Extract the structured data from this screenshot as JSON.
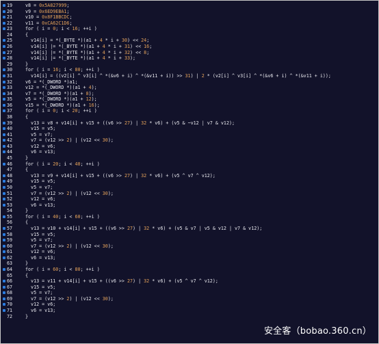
{
  "lines": [
    {
      "n": "19",
      "bullet": true,
      "code": "v8 = 0x5A827999;"
    },
    {
      "n": "20",
      "bullet": true,
      "code": "v9 = 0x6ED9EBA1;"
    },
    {
      "n": "21",
      "bullet": true,
      "code": "v10 = 0x8F1BBCDC;"
    },
    {
      "n": "22",
      "bullet": true,
      "code": "v11 = 0xCA62C1D6;"
    },
    {
      "n": "23",
      "bullet": true,
      "code": "for ( i = 0; i < 16; ++i )"
    },
    {
      "n": "24",
      "bullet": false,
      "code": "{"
    },
    {
      "n": "25",
      "bullet": true,
      "code": "  v14[i] = *(_BYTE *)(a1 + 4 * i + 30) << 24;"
    },
    {
      "n": "26",
      "bullet": true,
      "code": "  v14[i] |= *(_BYTE *)(a1 + 4 * i + 31) << 16;"
    },
    {
      "n": "27",
      "bullet": true,
      "code": "  v14[i] |= *(_BYTE *)(a1 + 4 * i + 32) << 8;"
    },
    {
      "n": "28",
      "bullet": true,
      "code": "  v14[i] |= *(_BYTE *)(a1 + 4 * i + 33);"
    },
    {
      "n": "29",
      "bullet": false,
      "code": "}"
    },
    {
      "n": "30",
      "bullet": true,
      "code": "for ( i = 16; i < 80; ++i )"
    },
    {
      "n": "31",
      "bullet": true,
      "code": "  v14[i] = ((v2[i] ^ v3[i] ^ *(&v6 + i) ^ *(&v11 + i)) >> 31) | 2 * (v2[i] ^ v3[i] ^ *(&v6 + i) ^ *(&v11 + i));"
    },
    {
      "n": "32",
      "bullet": true,
      "code": "v6 = *(_DWORD *)a1;"
    },
    {
      "n": "33",
      "bullet": true,
      "code": "v12 = *(_DWORD *)(a1 + 4);"
    },
    {
      "n": "34",
      "bullet": true,
      "code": "v7 = *(_DWORD *)(a1 + 8);"
    },
    {
      "n": "35",
      "bullet": true,
      "code": "v5 = *(_DWORD *)(a1 + 12);"
    },
    {
      "n": "36",
      "bullet": true,
      "code": "v15 = *(_DWORD *)(a1 + 16);"
    },
    {
      "n": "37",
      "bullet": true,
      "code": "for ( i = 0; i < 20; ++i )"
    },
    {
      "n": "38",
      "bullet": false,
      "code": "{"
    },
    {
      "n": "39",
      "bullet": true,
      "code": "  v13 = v8 + v14[i] + v15 + ((v6 >> 27) | 32 * v6) + (v5 & ~v12 | v7 & v12);"
    },
    {
      "n": "40",
      "bullet": true,
      "code": "  v15 = v5;"
    },
    {
      "n": "41",
      "bullet": true,
      "code": "  v5 = v7;"
    },
    {
      "n": "42",
      "bullet": true,
      "code": "  v7 = (v12 >> 2) | (v12 << 30);"
    },
    {
      "n": "43",
      "bullet": true,
      "code": "  v12 = v6;"
    },
    {
      "n": "44",
      "bullet": true,
      "code": "  v6 = v13;"
    },
    {
      "n": "45",
      "bullet": false,
      "code": "}"
    },
    {
      "n": "46",
      "bullet": true,
      "code": "for ( i = 20; i < 40; ++i )"
    },
    {
      "n": "47",
      "bullet": false,
      "code": "{"
    },
    {
      "n": "48",
      "bullet": true,
      "code": "  v13 = v9 + v14[i] + v15 + ((v6 >> 27) | 32 * v6) + (v5 ^ v7 ^ v12);"
    },
    {
      "n": "49",
      "bullet": true,
      "code": "  v15 = v5;"
    },
    {
      "n": "50",
      "bullet": true,
      "code": "  v5 = v7;"
    },
    {
      "n": "51",
      "bullet": true,
      "code": "  v7 = (v12 >> 2) | (v12 << 30);"
    },
    {
      "n": "52",
      "bullet": true,
      "code": "  v12 = v6;"
    },
    {
      "n": "53",
      "bullet": true,
      "code": "  v6 = v13;"
    },
    {
      "n": "54",
      "bullet": false,
      "code": "}"
    },
    {
      "n": "55",
      "bullet": true,
      "code": "for ( i = 40; i < 60; ++i )"
    },
    {
      "n": "56",
      "bullet": false,
      "code": "{"
    },
    {
      "n": "57",
      "bullet": true,
      "code": "  v13 = v10 + v14[i] + v15 + ((v6 >> 27) | 32 * v6) + (v5 & v7 | v5 & v12 | v7 & v12);"
    },
    {
      "n": "58",
      "bullet": true,
      "code": "  v15 = v5;"
    },
    {
      "n": "59",
      "bullet": true,
      "code": "  v5 = v7;"
    },
    {
      "n": "60",
      "bullet": true,
      "code": "  v7 = (v12 >> 2) | (v12 << 30);"
    },
    {
      "n": "61",
      "bullet": true,
      "code": "  v12 = v6;"
    },
    {
      "n": "62",
      "bullet": true,
      "code": "  v6 = v13;"
    },
    {
      "n": "63",
      "bullet": false,
      "code": "}"
    },
    {
      "n": "64",
      "bullet": true,
      "code": "for ( i = 60; i < 80; ++i )"
    },
    {
      "n": "65",
      "bullet": false,
      "code": "{"
    },
    {
      "n": "66",
      "bullet": true,
      "code": "  v13 = v11 + v14[i] + v15 + ((v6 >> 27) | 32 * v6) + (v5 ^ v7 ^ v12);"
    },
    {
      "n": "67",
      "bullet": true,
      "code": "  v15 = v5;"
    },
    {
      "n": "68",
      "bullet": true,
      "code": "  v5 = v7;"
    },
    {
      "n": "69",
      "bullet": true,
      "code": "  v7 = (v12 >> 2) | (v12 << 30);"
    },
    {
      "n": "70",
      "bullet": true,
      "code": "  v12 = v6;"
    },
    {
      "n": "71",
      "bullet": true,
      "code": "  v6 = v13;"
    },
    {
      "n": "72",
      "bullet": false,
      "code": "}"
    }
  ],
  "watermark": "安全客（bobao.360.cn）",
  "colors": {
    "background": "#12122a",
    "bullet": "#2b7de0",
    "number": "#e6a35a",
    "text": "#e8e8ee"
  }
}
